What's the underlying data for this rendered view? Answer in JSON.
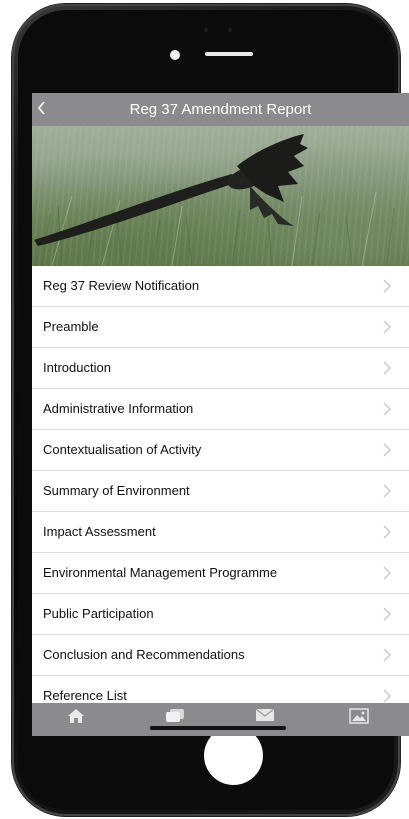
{
  "app": {
    "title": "Reg 37 Amendment Report"
  },
  "nav": {
    "back_icon": "chevron-left-icon"
  },
  "hero": {
    "subject": "bird-in-flight-photo"
  },
  "menu": {
    "items": [
      {
        "label": "Reg 37 Review Notification"
      },
      {
        "label": "Preamble"
      },
      {
        "label": "Introduction"
      },
      {
        "label": "Administrative Information"
      },
      {
        "label": "Contextualisation of Activity"
      },
      {
        "label": "Summary of Environment"
      },
      {
        "label": "Impact Assessment"
      },
      {
        "label": "Environmental Management Programme"
      },
      {
        "label": "Public Participation"
      },
      {
        "label": "Conclusion and Recommendations"
      },
      {
        "label": "Reference List"
      }
    ]
  },
  "tabbar": {
    "icons": [
      "home-icon",
      "chat-icon",
      "mail-icon",
      "image-icon"
    ]
  },
  "colors": {
    "bar": "#8b8b8d",
    "divider": "#dcdcdc",
    "chevron": "#c7c7cc"
  }
}
